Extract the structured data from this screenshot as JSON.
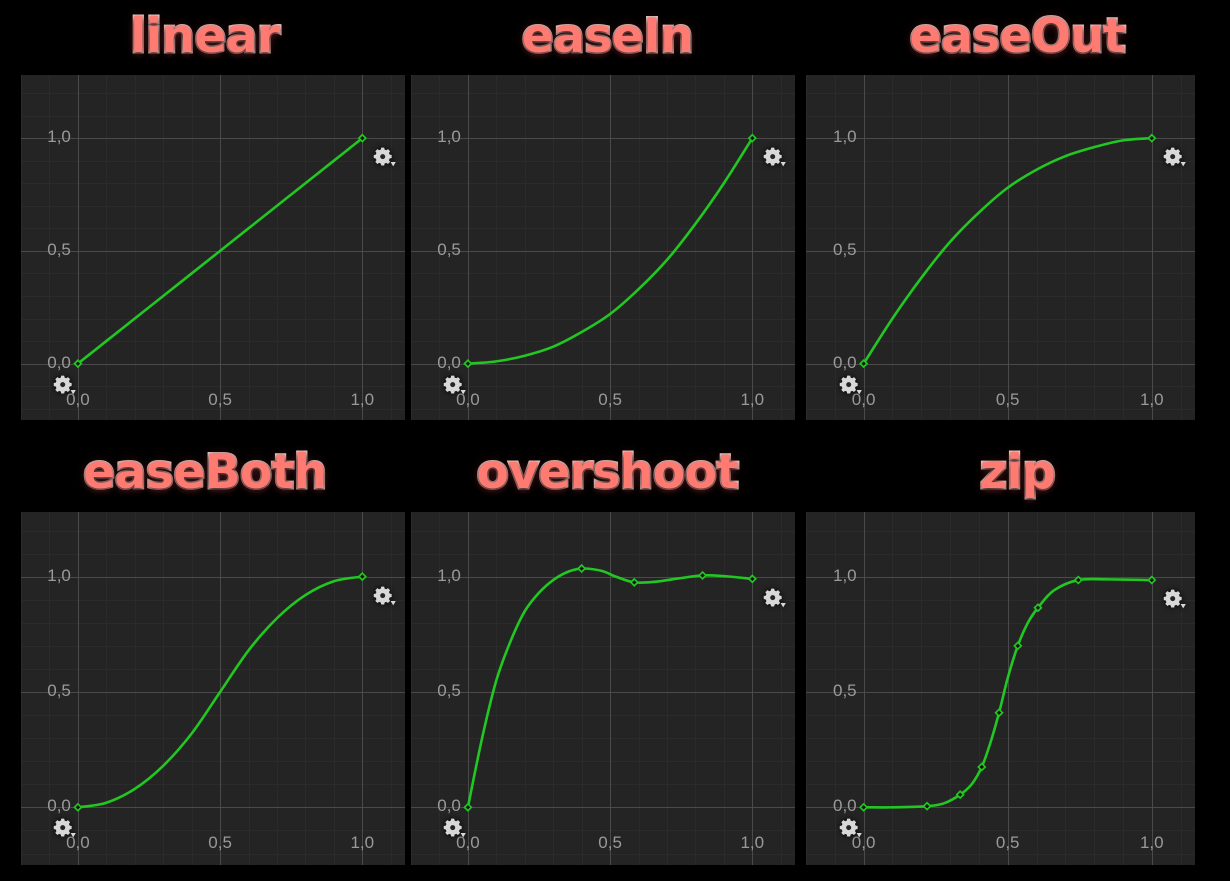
{
  "page": {
    "background": "#000000",
    "panel_background": "#242424",
    "curve_color": "#22c722",
    "title_color": "#ff7b72",
    "title_outline_color": "#ffe9e6",
    "axis_label_color": "#9a9a9a",
    "gridline_major_color": "#4a4a4a",
    "gridline_minor_color": "#2b2b2b"
  },
  "axes": {
    "x_ticks": [
      "0,0",
      "0,5",
      "1,0"
    ],
    "y_ticks": [
      "0,0",
      "0,5",
      "1,0"
    ],
    "x_tick_values": [
      0.0,
      0.5,
      1.0
    ],
    "y_tick_values": [
      0.0,
      0.5,
      1.0
    ],
    "xlim": [
      -0.2,
      1.15
    ],
    "ylim": [
      -0.25,
      1.28
    ],
    "minor_step": 0.1
  },
  "icons": {
    "gear": "gear-icon",
    "gear_dropdown": "gear-dropdown-icon"
  },
  "chart_data": [
    {
      "type": "line",
      "title": "linear",
      "xlabel": "",
      "ylabel": "",
      "xlim": [
        -0.2,
        1.15
      ],
      "ylim": [
        -0.25,
        1.28
      ],
      "grid": true,
      "legend": "none",
      "x": [
        0.0,
        1.0
      ],
      "y": [
        0.0,
        1.0
      ],
      "markers": [
        [
          0.0,
          0.0
        ],
        [
          1.0,
          1.0
        ]
      ],
      "samples_x": [
        0.0,
        0.1,
        0.2,
        0.3,
        0.4,
        0.5,
        0.6,
        0.7,
        0.8,
        0.9,
        1.0
      ],
      "samples_y": [
        0.0,
        0.1,
        0.2,
        0.3,
        0.4,
        0.5,
        0.6,
        0.7,
        0.8,
        0.9,
        1.0
      ]
    },
    {
      "type": "line",
      "title": "easeIn",
      "xlabel": "",
      "ylabel": "",
      "xlim": [
        -0.2,
        1.15
      ],
      "ylim": [
        -0.25,
        1.28
      ],
      "grid": true,
      "legend": "none",
      "markers": [
        [
          0.0,
          0.0
        ],
        [
          1.0,
          1.0
        ]
      ],
      "samples_x": [
        0.0,
        0.1,
        0.2,
        0.3,
        0.4,
        0.5,
        0.6,
        0.7,
        0.8,
        0.9,
        1.0
      ],
      "samples_y": [
        0.0,
        0.01,
        0.035,
        0.075,
        0.14,
        0.22,
        0.33,
        0.46,
        0.62,
        0.8,
        1.0
      ]
    },
    {
      "type": "line",
      "title": "easeOut",
      "xlabel": "",
      "ylabel": "",
      "xlim": [
        -0.2,
        1.15
      ],
      "ylim": [
        -0.25,
        1.28
      ],
      "grid": true,
      "legend": "none",
      "markers": [
        [
          0.0,
          0.0
        ],
        [
          1.0,
          1.0
        ]
      ],
      "samples_x": [
        0.0,
        0.1,
        0.2,
        0.3,
        0.4,
        0.5,
        0.6,
        0.7,
        0.8,
        0.9,
        1.0
      ],
      "samples_y": [
        0.0,
        0.2,
        0.38,
        0.54,
        0.67,
        0.78,
        0.86,
        0.92,
        0.96,
        0.99,
        1.0
      ]
    },
    {
      "type": "line",
      "title": "easeBoth",
      "xlabel": "",
      "ylabel": "",
      "xlim": [
        -0.2,
        1.15
      ],
      "ylim": [
        -0.25,
        1.28
      ],
      "grid": true,
      "legend": "none",
      "markers": [
        [
          0.0,
          0.0
        ],
        [
          1.0,
          1.0
        ]
      ],
      "samples_x": [
        0.0,
        0.1,
        0.2,
        0.3,
        0.4,
        0.5,
        0.6,
        0.7,
        0.8,
        0.9,
        1.0
      ],
      "samples_y": [
        0.0,
        0.02,
        0.08,
        0.18,
        0.32,
        0.5,
        0.68,
        0.82,
        0.92,
        0.98,
        1.0
      ]
    },
    {
      "type": "line",
      "title": "overshoot",
      "xlabel": "",
      "ylabel": "",
      "xlim": [
        -0.2,
        1.15
      ],
      "ylim": [
        -0.25,
        1.28
      ],
      "grid": true,
      "legend": "none",
      "markers": [
        [
          0.0,
          0.0
        ],
        [
          0.4,
          1.035
        ],
        [
          0.585,
          0.975
        ],
        [
          0.825,
          1.005
        ],
        [
          1.0,
          0.99
        ]
      ],
      "samples_x": [
        0.0,
        0.05,
        0.1,
        0.15,
        0.2,
        0.25,
        0.3,
        0.35,
        0.4,
        0.47,
        0.52,
        0.585,
        0.66,
        0.74,
        0.825,
        0.9,
        1.0
      ],
      "samples_y": [
        0.0,
        0.3,
        0.55,
        0.72,
        0.85,
        0.93,
        0.985,
        1.02,
        1.035,
        1.025,
        1.0,
        0.975,
        0.978,
        0.992,
        1.005,
        1.002,
        0.99
      ]
    },
    {
      "type": "line",
      "title": "zip",
      "xlabel": "",
      "ylabel": "",
      "xlim": [
        -0.2,
        1.15
      ],
      "ylim": [
        -0.25,
        1.28
      ],
      "grid": true,
      "legend": "none",
      "markers": [
        [
          0.0,
          0.0
        ],
        [
          0.22,
          0.005
        ],
        [
          0.335,
          0.055
        ],
        [
          0.41,
          0.175
        ],
        [
          0.47,
          0.41
        ],
        [
          0.535,
          0.7
        ],
        [
          0.605,
          0.865
        ],
        [
          0.745,
          0.985
        ],
        [
          1.0,
          0.985
        ]
      ],
      "samples_x": [
        0.0,
        0.11,
        0.22,
        0.28,
        0.335,
        0.375,
        0.41,
        0.44,
        0.47,
        0.5,
        0.535,
        0.57,
        0.605,
        0.66,
        0.745,
        0.85,
        1.0
      ],
      "samples_y": [
        0.0,
        0.0,
        0.005,
        0.018,
        0.055,
        0.1,
        0.175,
        0.28,
        0.41,
        0.56,
        0.7,
        0.8,
        0.865,
        0.94,
        0.985,
        0.988,
        0.985
      ]
    }
  ]
}
